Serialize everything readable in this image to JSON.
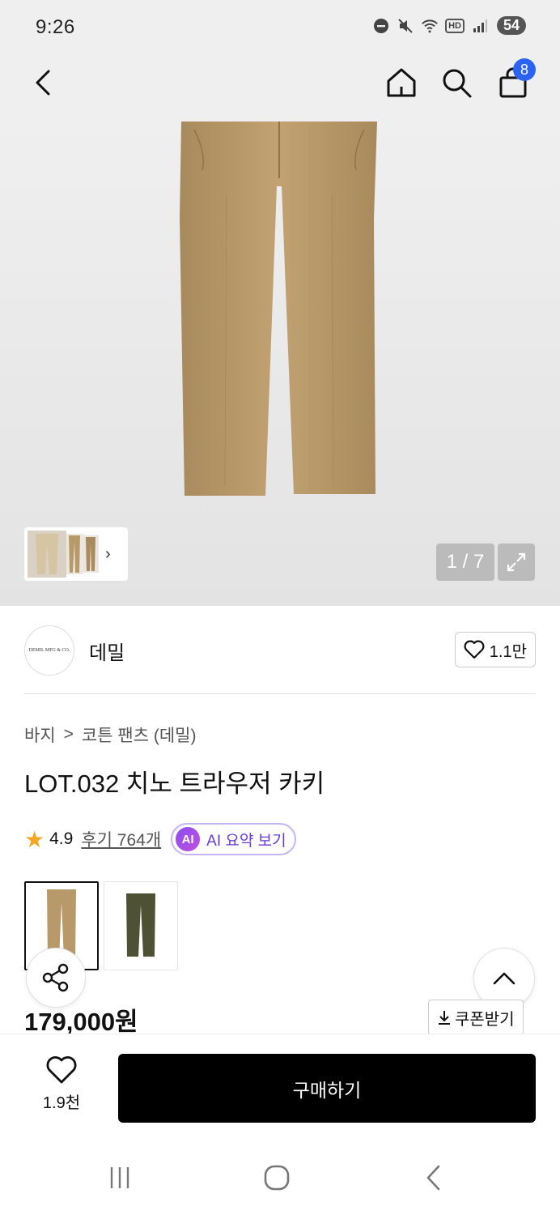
{
  "status_bar": {
    "time": "9:26",
    "network": "HD",
    "battery": "54"
  },
  "nav": {
    "cart_count": "8"
  },
  "gallery": {
    "page_counter": "1 / 7",
    "thumbnail_more": "›"
  },
  "brand": {
    "logo_text": "DEMIL MFG & CO.",
    "name": "데밀",
    "likes": "1.1만"
  },
  "breadcrumb": {
    "level1": "바지",
    "separator": ">",
    "level2": "코튼 팬츠 (데밀)"
  },
  "product": {
    "title": "LOT.032 치노 트라우저 카키",
    "rating": "4.9",
    "reviews": "후기 764개",
    "ai_chip": "AI",
    "ai_summary_label": "AI 요약 보기",
    "price": "179,000원",
    "coupon_label": "쿠폰받기"
  },
  "swatches": [
    {
      "color": "#b89a6a",
      "selected": true
    },
    {
      "color": "#4f5135",
      "selected": false
    }
  ],
  "bottom": {
    "wish_count": "1.9천",
    "buy_label": "구매하기"
  },
  "colors": {
    "accent": "#2b63f0",
    "ai_purple": "#6a3bd6",
    "star": "#f5a623",
    "khaki": "#b89a6a"
  }
}
